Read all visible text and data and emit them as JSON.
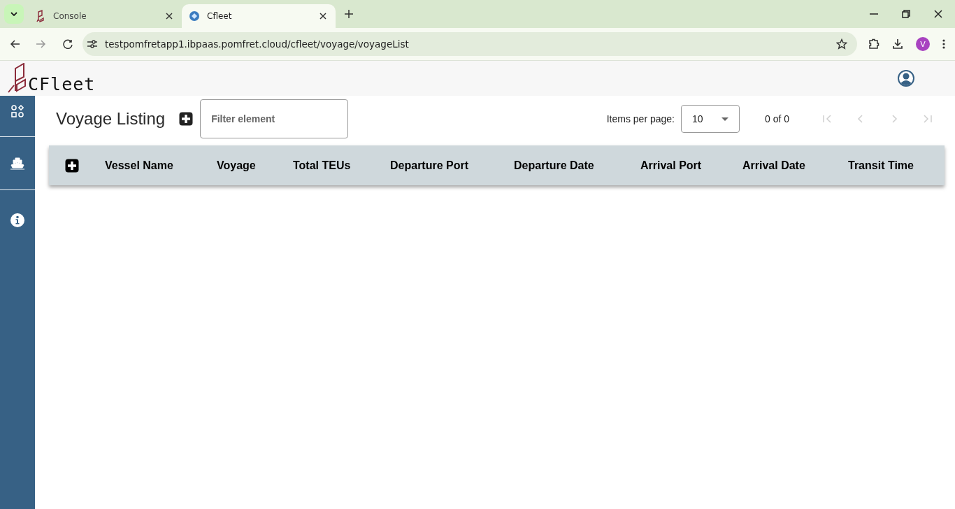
{
  "browser": {
    "tabs": [
      {
        "title": "Console",
        "selected": false
      },
      {
        "title": "Cfleet",
        "selected": true
      }
    ],
    "url": "testpomfretapp1.ibpaas.pomfret.cloud/cfleet/voyage/voyageList",
    "profile_initial": "V"
  },
  "app": {
    "logo_text": "CFleet"
  },
  "page": {
    "title": "Voyage Listing",
    "filter": {
      "placeholder": "Filter element"
    },
    "paginator": {
      "label": "Items per page:",
      "page_size": "10",
      "range": "0 of 0",
      "nav_buttons": [
        {
          "kind": "first",
          "disabled": true
        },
        {
          "kind": "previous",
          "disabled": true
        },
        {
          "kind": "next",
          "disabled": true
        },
        {
          "kind": "last",
          "disabled": true
        }
      ]
    },
    "table": {
      "columns": [
        "Vessel Name",
        "Voyage",
        "Total TEUs",
        "Departure Port",
        "Departure Date",
        "Arrival Port",
        "Arrival Date",
        "Transit Time"
      ]
    }
  }
}
